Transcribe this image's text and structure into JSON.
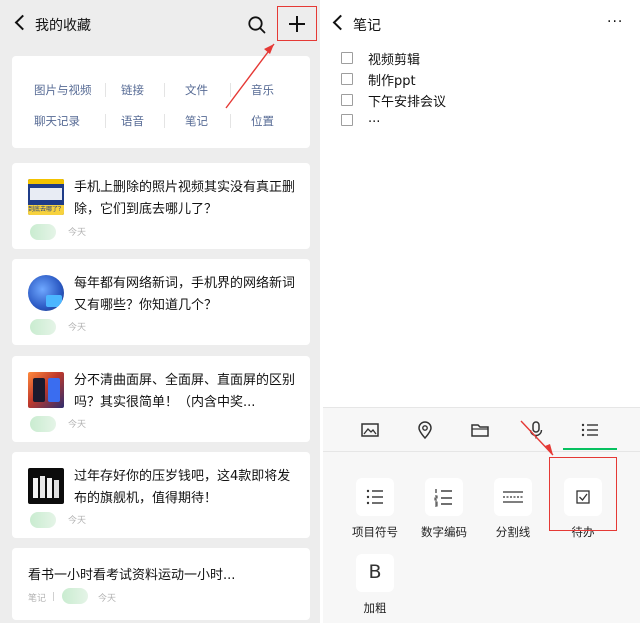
{
  "left": {
    "title": "我的收藏",
    "categories": [
      {
        "label": "图片与视频"
      },
      {
        "label": "链接"
      },
      {
        "label": "文件"
      },
      {
        "label": "音乐"
      },
      {
        "label": "聊天记录"
      },
      {
        "label": "语音"
      },
      {
        "label": "笔记"
      },
      {
        "label": "位置"
      }
    ],
    "items": [
      {
        "title": "手机上删除的照片视频其实没有真正删除，它们到底去哪儿了？",
        "time": "今天",
        "thumb_text": "到底去哪了？"
      },
      {
        "title": "每年都有网络新词，手机界的网络新词又有哪些？你知道几个？",
        "time": "今天"
      },
      {
        "title": "分不清曲面屏、全面屏、直面屏的区别吗？其实很简单！（内含中奖...",
        "time": "今天"
      },
      {
        "title": "过年存好你的压岁钱吧，这4款即将发布的旗舰机，值得期待！",
        "time": "今天"
      },
      {
        "title": "看书一小时看考试资料运动一小时...",
        "type": "笔记",
        "time": "今天"
      }
    ]
  },
  "right": {
    "title": "笔记",
    "more": "···",
    "todos": [
      {
        "text": "视频剪辑"
      },
      {
        "text": "制作ppt"
      },
      {
        "text": "下午安排会议"
      },
      {
        "text": "..."
      }
    ],
    "formats": [
      {
        "label": "项目符号"
      },
      {
        "label": "数字编码"
      },
      {
        "label": "分割线"
      },
      {
        "label": "待办"
      },
      {
        "label": "加粗",
        "glyph": "B"
      }
    ]
  },
  "colors": {
    "highlight": "#e53935",
    "accent_green": "#07c160",
    "link_blue": "#576b95"
  }
}
